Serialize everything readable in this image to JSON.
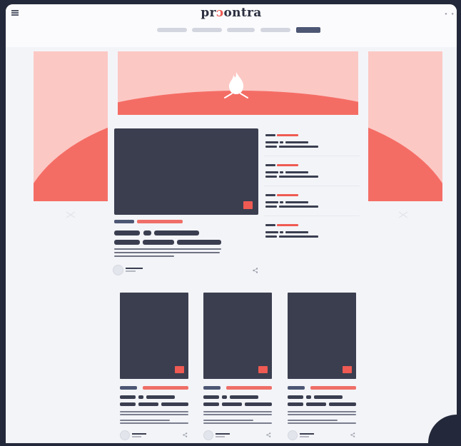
{
  "app": {
    "logo_prefix": "pr",
    "logo_accent": "ɔ",
    "logo_suffix": "ontra",
    "top_right_dots": "● ●"
  },
  "nav": {
    "item_count": 5,
    "active_index": 4
  },
  "icons": {
    "menu": "hamburger-icon",
    "hero": "flame-icon",
    "side_left": "chevron-pair-icon",
    "side_right": "chevron-pair-icon",
    "share": "share-icon"
  },
  "colors": {
    "background": "#23283a",
    "page": "#f3f4f8",
    "accent": "#ef5a52",
    "accent_light": "#fcc8c4",
    "dark_block": "#3b3e4f",
    "nav_active": "#4d5774"
  },
  "feature": {
    "image_placeholder": "feature-image",
    "has_badge": true
  },
  "sidebar_list": {
    "item_count": 4
  },
  "cards": {
    "count": 3
  }
}
